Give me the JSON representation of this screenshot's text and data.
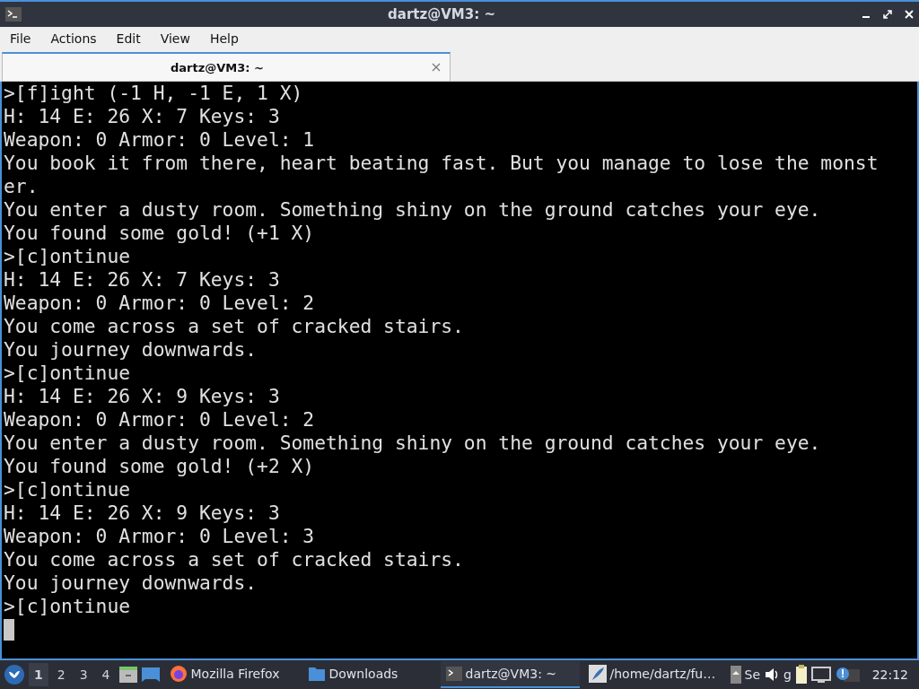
{
  "window": {
    "title": "dartz@VM3: ~"
  },
  "menu": [
    "File",
    "Actions",
    "Edit",
    "View",
    "Help"
  ],
  "tabs": [
    {
      "label": "dartz@VM3: ~",
      "selected": true
    }
  ],
  "terminal": {
    "lines": [
      ">[f]ight (-1 H, -1 E, 1 X)",
      "H: 14 E: 26 X: 7 Keys: 3",
      "Weapon: 0 Armor: 0 Level: 1",
      "You book it from there, heart beating fast. But you manage to lose the monst",
      "er.",
      "You enter a dusty room. Something shiny on the ground catches your eye.",
      "You found some gold! (+1 X)",
      ">[c]ontinue",
      "H: 14 E: 26 X: 7 Keys: 3",
      "Weapon: 0 Armor: 0 Level: 2",
      "You come across a set of cracked stairs.",
      "You journey downwards.",
      ">[c]ontinue",
      "H: 14 E: 26 X: 9 Keys: 3",
      "Weapon: 0 Armor: 0 Level: 2",
      "You enter a dusty room. Something shiny on the ground catches your eye.",
      "You found some gold! (+2 X)",
      ">[c]ontinue",
      "H: 14 E: 26 X: 9 Keys: 3",
      "Weapon: 0 Armor: 0 Level: 3",
      "You come across a set of cracked stairs.",
      "You journey downwards.",
      ">[c]ontinue"
    ]
  },
  "taskbar": {
    "workspaces": [
      {
        "label": "1",
        "selected": true
      },
      {
        "label": "2",
        "selected": false
      },
      {
        "label": "3",
        "selected": false
      },
      {
        "label": "4",
        "selected": false
      }
    ],
    "tasks": [
      {
        "kind": "firefox",
        "label": "Mozilla Firefox",
        "selected": false
      },
      {
        "kind": "folder",
        "label": "Downloads",
        "selected": false
      },
      {
        "kind": "terminal",
        "label": "dartz@VM3: ~",
        "selected": true
      },
      {
        "kind": "editor",
        "label": "/home/dartz/fu…",
        "selected": false
      }
    ],
    "tray_texts": [
      "Se",
      "g"
    ],
    "clock": "22:12"
  }
}
